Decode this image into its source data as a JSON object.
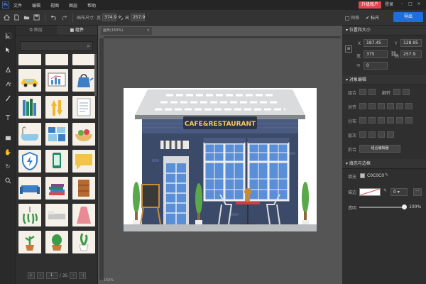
{
  "app": {
    "logo_text": "Ps"
  },
  "menu": [
    "文件",
    "编辑",
    "视图",
    "图层",
    "帮助"
  ],
  "header": {
    "upgrade_label": "升级账户",
    "login_label": "登录",
    "export_label": "导出"
  },
  "toolbar": {
    "canvas_size_label": "画布尺寸:",
    "width_label": "宽",
    "width_value": "374.9",
    "height_label": "高",
    "height_value": "257.9",
    "grid_label": "网格",
    "ruler_label": "标尺"
  },
  "left_panel": {
    "tabs": [
      "图层",
      "组件"
    ],
    "active_tab": "组件",
    "search_placeholder": "",
    "pager": {
      "current": "1",
      "total_text": "/ 35"
    }
  },
  "document": {
    "tab_label": "画布(150%)",
    "zoom_readout": "150%"
  },
  "canvas": {
    "sign_text": "CAFE&RESTAURANT"
  },
  "right_panel": {
    "position_size": {
      "title": "位置和大小",
      "x_label": "X",
      "x_value": "187.45",
      "y_label": "Y",
      "y_value": "128.95",
      "w_label": "宽",
      "w_value": "375",
      "h_label": "高",
      "h_value": "257.9",
      "rotation_value": "0"
    },
    "object_edit": {
      "title": "对象编辑",
      "group_label": "组合",
      "flip_label": "翻转",
      "align_label": "对齐",
      "distribute_label": "分布",
      "layer_label": "层次",
      "merge_label": "拆合",
      "group_editor_label": "组合编辑器"
    },
    "fill_stroke": {
      "title": "填充与边框",
      "fill_label": "填充",
      "fill_value": "C0C0C0",
      "stroke_label": "描边",
      "stroke_width": "0",
      "opacity_label": "透明",
      "opacity_value": "100%"
    }
  },
  "colors": {
    "accent": "#1f6fd8",
    "upgrade": "#e0474c",
    "building": "#3b4a68",
    "sign": "#2d3548"
  }
}
